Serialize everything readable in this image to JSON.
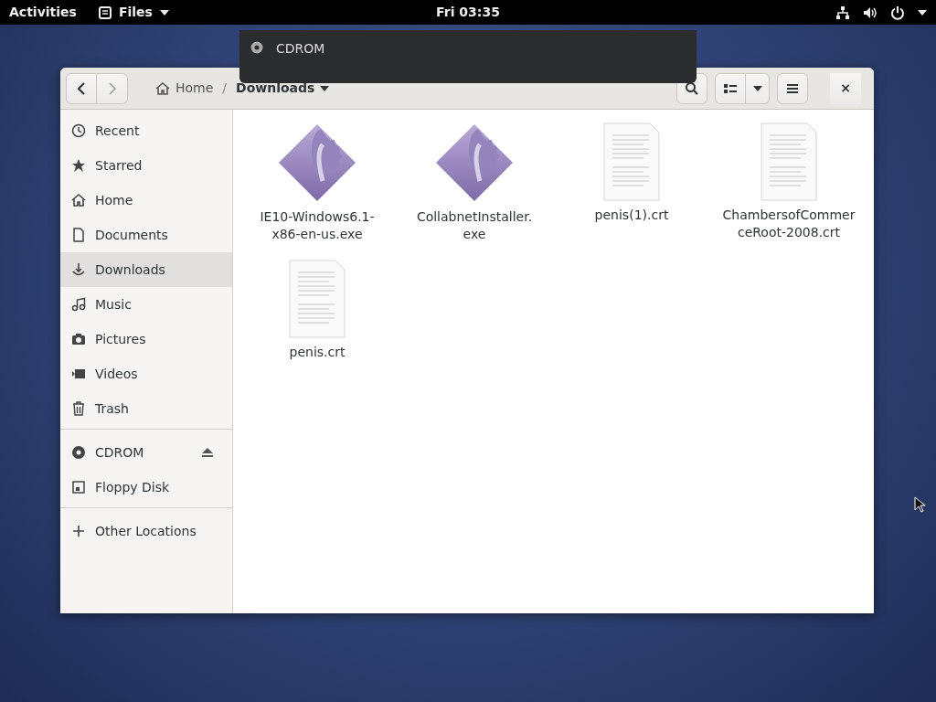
{
  "top_bar": {
    "activities": "Activities",
    "app_menu": "Files",
    "clock": "Fri 03:35"
  },
  "notification": {
    "title": "CDROM"
  },
  "window": {
    "path_separator": "/",
    "path": [
      {
        "label": "Home",
        "selected": false
      },
      {
        "label": "Downloads",
        "selected": true
      }
    ],
    "close": "×"
  },
  "sidebar": {
    "groups": [
      [
        {
          "label": "Recent",
          "selected": false
        },
        {
          "label": "Starred",
          "selected": false
        },
        {
          "label": "Home",
          "selected": false
        },
        {
          "label": "Documents",
          "selected": false
        },
        {
          "label": "Downloads",
          "selected": true
        },
        {
          "label": "Music",
          "selected": false
        },
        {
          "label": "Pictures",
          "selected": false
        },
        {
          "label": "Videos",
          "selected": false
        },
        {
          "label": "Trash",
          "selected": false
        }
      ],
      [
        {
          "label": "CDROM",
          "selected": false,
          "eject": true
        },
        {
          "label": "Floppy Disk",
          "selected": false,
          "eject": false
        }
      ],
      [
        {
          "label": "Other Locations",
          "selected": false
        }
      ]
    ]
  },
  "files": [
    {
      "kind": "exe",
      "name_lines": [
        "IE10-Windows6.1-",
        "x86-en-us.exe"
      ]
    },
    {
      "kind": "exe",
      "name_lines": [
        "CollabnetInstaller.",
        "exe"
      ]
    },
    {
      "kind": "doc",
      "name_lines": [
        "penis(1).crt"
      ]
    },
    {
      "kind": "doc",
      "name_lines": [
        "ChambersofCommer",
        "ceRoot-2008.crt"
      ]
    },
    {
      "kind": "doc",
      "name_lines": [
        "penis.crt"
      ]
    }
  ]
}
